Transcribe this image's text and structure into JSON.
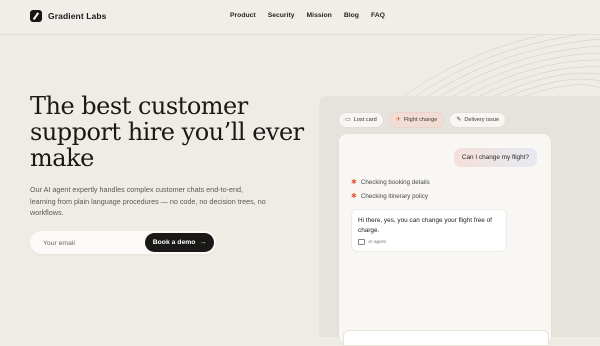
{
  "brand": {
    "name": "Gradient Labs"
  },
  "nav": {
    "links": [
      "Product",
      "Security",
      "Mission",
      "Blog",
      "FAQ"
    ]
  },
  "hero": {
    "headline": "The best customer support hire you’ll ever make",
    "description": "Our AI agent expertly handles complex customer chats end-to-end, learning from plain language procedures — no code, no decision trees, no workflows."
  },
  "signup": {
    "email_placeholder": "Your email",
    "button_label": "Book a demo",
    "button_icon": "→"
  },
  "demo": {
    "tabs": [
      {
        "label": "Lost card",
        "icon": "card-icon"
      },
      {
        "label": "Flight change",
        "icon": "plane-icon",
        "active": true
      },
      {
        "label": "Delivery issue",
        "icon": "wrench-icon"
      }
    ],
    "user_message": "Can I change my flight?",
    "steps": [
      "Checking booking details",
      "Checking itinerary policy"
    ],
    "agent_message": "Hi there, yes, you can change your flight free of charge.",
    "agent_tag": "AI agent"
  },
  "colors": {
    "accent": "#e2603d",
    "background": "#efece6",
    "dark": "#1a1917"
  }
}
